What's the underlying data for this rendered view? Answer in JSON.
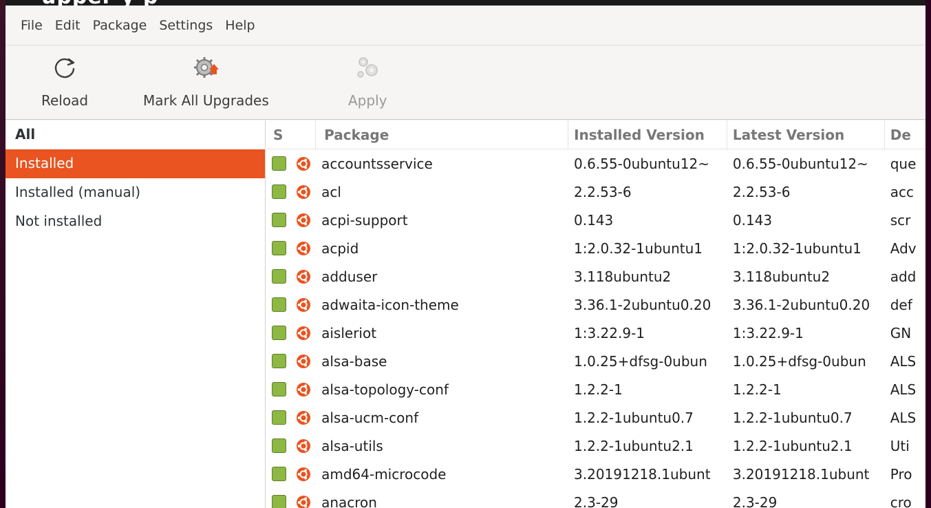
{
  "window": {
    "title_fragment": "upper      y  p"
  },
  "menubar": {
    "items": [
      "File",
      "Edit",
      "Package",
      "Settings",
      "Help"
    ]
  },
  "toolbar": {
    "reload_label": "Reload",
    "mark_all_label": "Mark All Upgrades",
    "apply_label": "Apply"
  },
  "sidebar": {
    "items": [
      {
        "label": "All",
        "state": "header"
      },
      {
        "label": "Installed",
        "state": "selected"
      },
      {
        "label": "Installed (manual)",
        "state": "normal"
      },
      {
        "label": "Not installed",
        "state": "normal"
      }
    ]
  },
  "table": {
    "columns": {
      "s": "S",
      "package": "Package",
      "installed": "Installed Version",
      "latest": "Latest Version",
      "desc": "De"
    },
    "rows": [
      {
        "package": "accountsservice",
        "installed": "0.6.55-0ubuntu12~",
        "latest": "0.6.55-0ubuntu12~",
        "desc": "que"
      },
      {
        "package": "acl",
        "installed": "2.2.53-6",
        "latest": "2.2.53-6",
        "desc": "acc"
      },
      {
        "package": "acpi-support",
        "installed": "0.143",
        "latest": "0.143",
        "desc": "scr"
      },
      {
        "package": "acpid",
        "installed": "1:2.0.32-1ubuntu1",
        "latest": "1:2.0.32-1ubuntu1",
        "desc": "Adv"
      },
      {
        "package": "adduser",
        "installed": "3.118ubuntu2",
        "latest": "3.118ubuntu2",
        "desc": "add"
      },
      {
        "package": "adwaita-icon-theme",
        "installed": "3.36.1-2ubuntu0.20",
        "latest": "3.36.1-2ubuntu0.20",
        "desc": "def"
      },
      {
        "package": "aisleriot",
        "installed": "1:3.22.9-1",
        "latest": "1:3.22.9-1",
        "desc": "GN"
      },
      {
        "package": "alsa-base",
        "installed": "1.0.25+dfsg-0ubun",
        "latest": "1.0.25+dfsg-0ubun",
        "desc": "ALS"
      },
      {
        "package": "alsa-topology-conf",
        "installed": "1.2.2-1",
        "latest": "1.2.2-1",
        "desc": "ALS"
      },
      {
        "package": "alsa-ucm-conf",
        "installed": "1.2.2-1ubuntu0.7",
        "latest": "1.2.2-1ubuntu0.7",
        "desc": "ALS"
      },
      {
        "package": "alsa-utils",
        "installed": "1.2.2-1ubuntu2.1",
        "latest": "1.2.2-1ubuntu2.1",
        "desc": "Uti"
      },
      {
        "package": "amd64-microcode",
        "installed": "3.20191218.1ubunt",
        "latest": "3.20191218.1ubunt",
        "desc": "Pro"
      },
      {
        "package": "anacron",
        "installed": "2.3-29",
        "latest": "2.3-29",
        "desc": "cro"
      }
    ]
  },
  "colors": {
    "accent": "#e95420",
    "status_installed": "#8db843",
    "ubuntu_logo": "#e95420"
  },
  "icons": {
    "reload": "reload-icon",
    "mark_all": "mark-upgrades-icon",
    "apply": "apply-icon",
    "status": "installed-status-icon",
    "origin": "ubuntu-logo-icon"
  }
}
